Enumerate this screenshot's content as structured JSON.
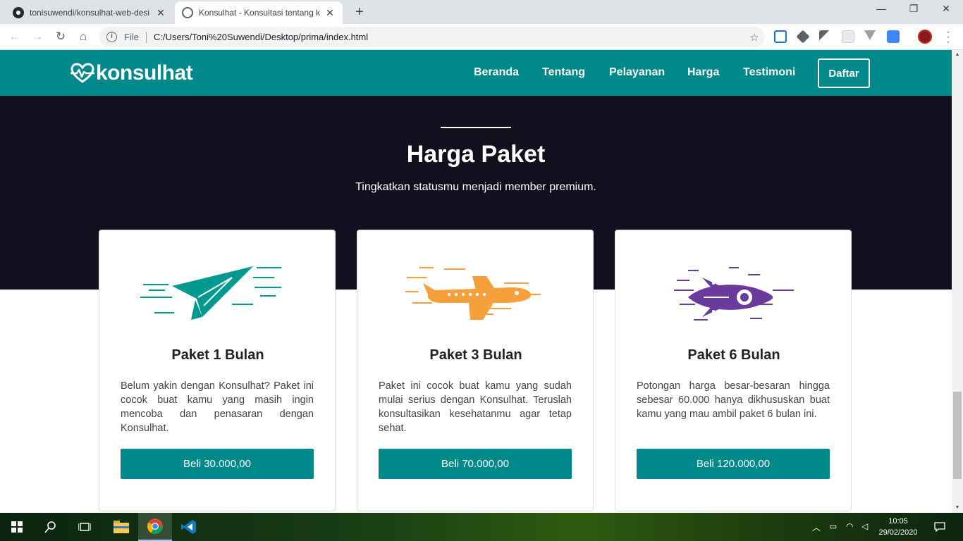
{
  "browser": {
    "tabs": [
      {
        "title": "tonisuwendi/konsulhat-web-desi",
        "favicon": "github-icon"
      },
      {
        "title": "Konsulhat - Konsultasi tentang ke",
        "favicon": "globe-icon"
      }
    ],
    "file_label": "File",
    "url": "C:/Users/Toni%20Suwendi/Desktop/prima/index.html"
  },
  "site": {
    "brand": "konsulhat",
    "nav": {
      "beranda": "Beranda",
      "tentang": "Tentang",
      "pelayanan": "Pelayanan",
      "harga": "Harga",
      "testimoni": "Testimoni",
      "daftar": "Daftar"
    },
    "section": {
      "title": "Harga Paket",
      "subtitle": "Tingkatkan statusmu menjadi member premium."
    },
    "plans": [
      {
        "title": "Paket 1 Bulan",
        "description": "Belum yakin dengan Konsulhat? Paket ini cocok buat kamu yang masih ingin mencoba dan penasaran dengan Konsulhat.",
        "button": "Beli 30.000,00",
        "icon": "paper-plane-icon",
        "color": "#00998f"
      },
      {
        "title": "Paket 3 Bulan",
        "description": "Paket ini cocok buat kamu yang sudah mulai serius dengan Konsulhat. Teruslah konsultasikan kesehatanmu agar tetap sehat.",
        "button": "Beli 70.000,00",
        "icon": "airplane-icon",
        "color": "#f5a03a"
      },
      {
        "title": "Paket 6 Bulan",
        "description": "Potongan harga besar-besaran hingga sebesar 60.000 hanya dikhususkan buat kamu yang mau ambil paket 6 bulan ini.",
        "button": "Beli 120.000,00",
        "icon": "rocket-icon",
        "color": "#6a3a9c"
      }
    ]
  },
  "taskbar": {
    "time": "10:05",
    "date": "29/02/2020"
  },
  "colors": {
    "primary": "#00898a",
    "dark_band": "#12101f"
  }
}
